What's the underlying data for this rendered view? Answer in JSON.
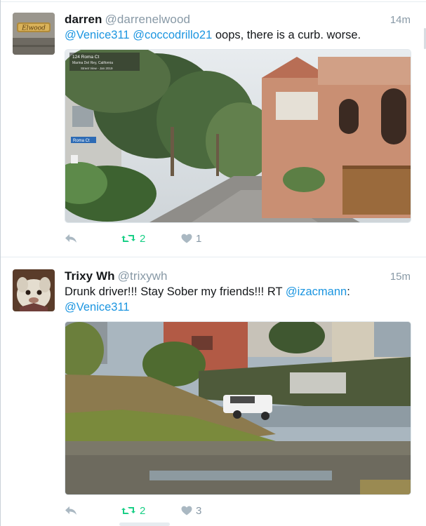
{
  "tweets": [
    {
      "name": "darren",
      "handle": "@darrenelwood",
      "time": "14m",
      "text_parts": [
        {
          "t": "@Venice311",
          "mention": true
        },
        {
          "t": " ",
          "mention": false
        },
        {
          "t": "@coccodrillo21",
          "mention": true
        },
        {
          "t": " oops, there is a curb. worse.",
          "mention": false
        }
      ],
      "avatar_logo": "Elwood",
      "media": {
        "overlay_address": "124 Roma Ct",
        "overlay_city": "Marina Del Rey, California",
        "overlay_sv": "Street View - Jan 2019",
        "street_sign": "Roma Ct"
      },
      "retweets": "2",
      "likes": "1"
    },
    {
      "name": "Trixy Wh",
      "handle": "@trixywh",
      "time": "15m",
      "text_parts": [
        {
          "t": "Drunk driver!!! Stay Sober my friends!!! RT ",
          "mention": false
        },
        {
          "t": "@izacmann",
          "mention": true
        },
        {
          "t": ":",
          "mention": false
        }
      ],
      "text_line2": "@Venice311",
      "retweets": "2",
      "likes": "3"
    }
  ],
  "icons": {
    "reply": "reply-icon",
    "retweet": "retweet-icon",
    "like": "heart-icon"
  },
  "colors": {
    "mention": "#1b95e0",
    "retweet": "#19cf86",
    "muted": "#8899a6"
  }
}
